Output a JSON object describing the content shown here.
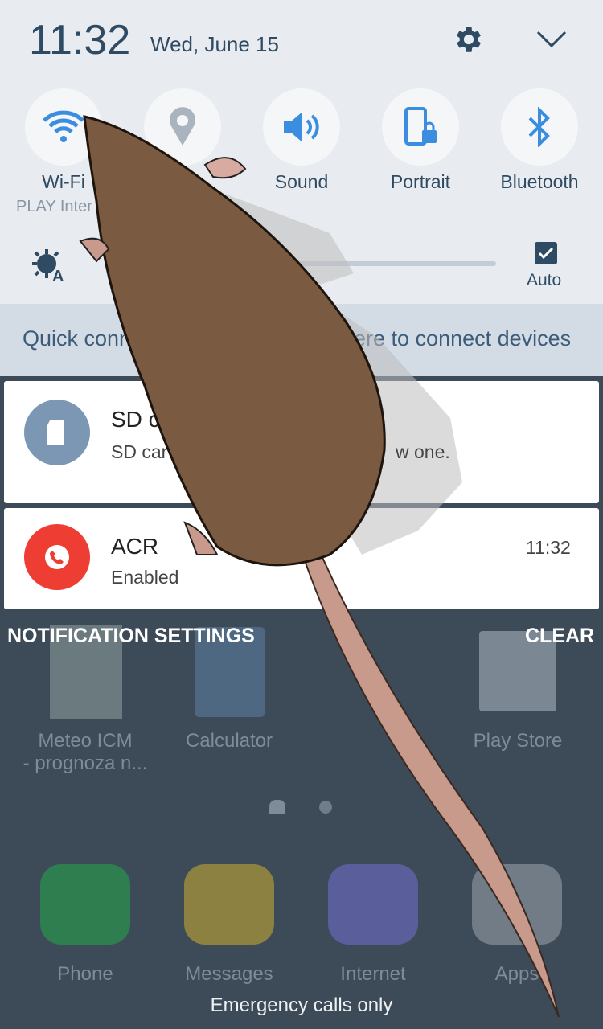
{
  "header": {
    "time": "11:32",
    "date": "Wed, June 15",
    "settings_icon": "gear-icon",
    "collapse_icon": "chevron-down-icon"
  },
  "quick_tiles": [
    {
      "label": "Wi-Fi",
      "sub": "PLAY Inter",
      "icon": "wifi-icon"
    },
    {
      "label": "",
      "icon": "location-icon"
    },
    {
      "label": "Sound",
      "icon": "sound-icon"
    },
    {
      "label": "Portrait",
      "icon": "portrait-lock-icon"
    },
    {
      "label": "Bluetooth",
      "icon": "bluetooth-icon"
    }
  ],
  "brightness": {
    "auto_label": "Auto",
    "auto_checked": true,
    "level_percent": 4
  },
  "quick_connect": {
    "left": "Quick conn",
    "right": "here to connect devices"
  },
  "notifications": [
    {
      "title": "SD ca",
      "text_left": "SD car",
      "text_right": "w one.",
      "icon": "sd-card-icon",
      "color": "#7b97b3"
    },
    {
      "title": "ACR",
      "text": "Enabled",
      "time": "11:32",
      "icon": "phone-record-icon",
      "color": "#ee3d33"
    }
  ],
  "actions": {
    "settings": "NOTIFICATION SETTINGS",
    "clear": "CLEAR"
  },
  "home": {
    "apps": [
      {
        "label1": "Meteo ICM",
        "label2": "- prognoza n..."
      },
      {
        "label1": "Calculator"
      },
      {
        "label1": "Play Store"
      }
    ],
    "dock": [
      "Phone",
      "Messages",
      "Internet",
      "Apps"
    ],
    "status": "Emergency calls only"
  }
}
